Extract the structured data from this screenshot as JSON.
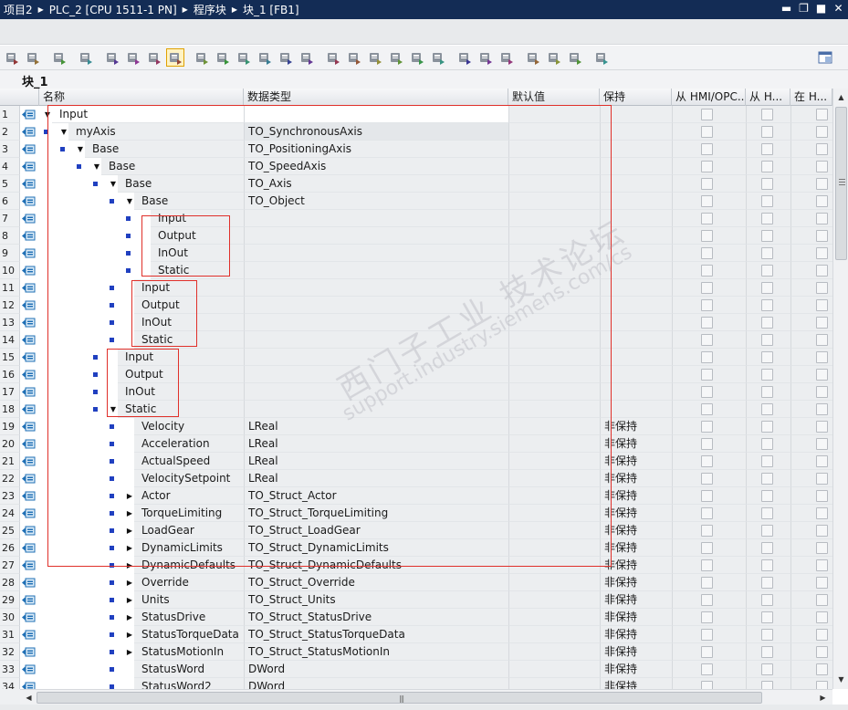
{
  "titlebar": {
    "crumbs": [
      "项目2",
      "PLC_2 [CPU 1511-1 PN]",
      "程序块",
      "块_1 [FB1]"
    ]
  },
  "block_title": "块_1",
  "columns": {
    "name": "名称",
    "datatype": "数据类型",
    "default": "默认值",
    "retain": "保持",
    "from_hmi": "从 HMI/OPC...",
    "from_h": "从 H...",
    "in_h": "在 H..."
  },
  "watermark": {
    "line1": "西门子工业  技术论坛",
    "line2": "support.industry.siemens.com/cs"
  },
  "icons": {
    "interface": "interface-port-icon",
    "expanded": "triangle-down-icon",
    "collapsed": "triangle-right-icon",
    "member": "square-bullet-icon"
  },
  "colors": {
    "titlebar": "#132c55",
    "annotation": "#e0302a",
    "bullet": "#2040c0"
  },
  "rows": [
    {
      "n": "1",
      "name": "Input",
      "level": 0,
      "tri": "down",
      "bullet": false,
      "type": "",
      "retain": ""
    },
    {
      "n": "2",
      "name": "myAxis",
      "level": 1,
      "tri": "down",
      "bullet": true,
      "type": "TO_SynchronousAxis",
      "retain": ""
    },
    {
      "n": "3",
      "name": "Base",
      "level": 2,
      "tri": "down",
      "bullet": true,
      "type": "TO_PositioningAxis",
      "retain": ""
    },
    {
      "n": "4",
      "name": "Base",
      "level": 3,
      "tri": "down",
      "bullet": true,
      "type": "TO_SpeedAxis",
      "retain": ""
    },
    {
      "n": "5",
      "name": "Base",
      "level": 4,
      "tri": "down",
      "bullet": true,
      "type": "TO_Axis",
      "retain": ""
    },
    {
      "n": "6",
      "name": "Base",
      "level": 5,
      "tri": "down",
      "bullet": true,
      "type": "TO_Object",
      "retain": ""
    },
    {
      "n": "7",
      "name": "Input",
      "level": 6,
      "tri": "",
      "bullet": true,
      "type": "",
      "retain": ""
    },
    {
      "n": "8",
      "name": "Output",
      "level": 6,
      "tri": "",
      "bullet": true,
      "type": "",
      "retain": ""
    },
    {
      "n": "9",
      "name": "InOut",
      "level": 6,
      "tri": "",
      "bullet": true,
      "type": "",
      "retain": ""
    },
    {
      "n": "10",
      "name": "Static",
      "level": 6,
      "tri": "",
      "bullet": true,
      "type": "",
      "retain": ""
    },
    {
      "n": "11",
      "name": "Input",
      "level": 5,
      "tri": "",
      "bullet": true,
      "type": "",
      "retain": ""
    },
    {
      "n": "12",
      "name": "Output",
      "level": 5,
      "tri": "",
      "bullet": true,
      "type": "",
      "retain": ""
    },
    {
      "n": "13",
      "name": "InOut",
      "level": 5,
      "tri": "",
      "bullet": true,
      "type": "",
      "retain": ""
    },
    {
      "n": "14",
      "name": "Static",
      "level": 5,
      "tri": "",
      "bullet": true,
      "type": "",
      "retain": ""
    },
    {
      "n": "15",
      "name": "Input",
      "level": 4,
      "tri": "",
      "bullet": true,
      "type": "",
      "retain": ""
    },
    {
      "n": "16",
      "name": "Output",
      "level": 4,
      "tri": "",
      "bullet": true,
      "type": "",
      "retain": ""
    },
    {
      "n": "17",
      "name": "InOut",
      "level": 4,
      "tri": "",
      "bullet": true,
      "type": "",
      "retain": ""
    },
    {
      "n": "18",
      "name": "Static",
      "level": 4,
      "tri": "down",
      "bullet": true,
      "type": "",
      "retain": ""
    },
    {
      "n": "19",
      "name": "Velocity",
      "level": 5,
      "tri": "",
      "bullet": true,
      "type": "LReal",
      "retain": "非保持"
    },
    {
      "n": "20",
      "name": "Acceleration",
      "level": 5,
      "tri": "",
      "bullet": true,
      "type": "LReal",
      "retain": "非保持"
    },
    {
      "n": "21",
      "name": "ActualSpeed",
      "level": 5,
      "tri": "",
      "bullet": true,
      "type": "LReal",
      "retain": "非保持"
    },
    {
      "n": "22",
      "name": "VelocitySetpoint",
      "level": 5,
      "tri": "",
      "bullet": true,
      "type": "LReal",
      "retain": "非保持"
    },
    {
      "n": "23",
      "name": "Actor",
      "level": 5,
      "tri": "right",
      "bullet": true,
      "type": "TO_Struct_Actor",
      "retain": "非保持"
    },
    {
      "n": "24",
      "name": "TorqueLimiting",
      "level": 5,
      "tri": "right",
      "bullet": true,
      "type": "TO_Struct_TorqueLimiting",
      "retain": "非保持"
    },
    {
      "n": "25",
      "name": "LoadGear",
      "level": 5,
      "tri": "right",
      "bullet": true,
      "type": "TO_Struct_LoadGear",
      "retain": "非保持"
    },
    {
      "n": "26",
      "name": "DynamicLimits",
      "level": 5,
      "tri": "right",
      "bullet": true,
      "type": "TO_Struct_DynamicLimits",
      "retain": "非保持"
    },
    {
      "n": "27",
      "name": "DynamicDefaults",
      "level": 5,
      "tri": "right",
      "bullet": true,
      "type": "TO_Struct_DynamicDefaults",
      "retain": "非保持"
    },
    {
      "n": "28",
      "name": "Override",
      "level": 5,
      "tri": "right",
      "bullet": true,
      "type": "TO_Struct_Override",
      "retain": "非保持"
    },
    {
      "n": "29",
      "name": "Units",
      "level": 5,
      "tri": "right",
      "bullet": true,
      "type": "TO_Struct_Units",
      "retain": "非保持"
    },
    {
      "n": "30",
      "name": "StatusDrive",
      "level": 5,
      "tri": "right",
      "bullet": true,
      "type": "TO_Struct_StatusDrive",
      "retain": "非保持"
    },
    {
      "n": "31",
      "name": "StatusTorqueData",
      "level": 5,
      "tri": "right",
      "bullet": true,
      "type": "TO_Struct_StatusTorqueData",
      "retain": "非保持"
    },
    {
      "n": "32",
      "name": "StatusMotionIn",
      "level": 5,
      "tri": "right",
      "bullet": true,
      "type": "TO_Struct_StatusMotionIn",
      "retain": "非保持"
    },
    {
      "n": "33",
      "name": "StatusWord",
      "level": 5,
      "tri": "",
      "bullet": true,
      "type": "DWord",
      "retain": "非保持"
    },
    {
      "n": "34",
      "name": "StatusWord2",
      "level": 5,
      "tri": "",
      "bullet": true,
      "type": "DWord",
      "retain": "非保持"
    }
  ]
}
